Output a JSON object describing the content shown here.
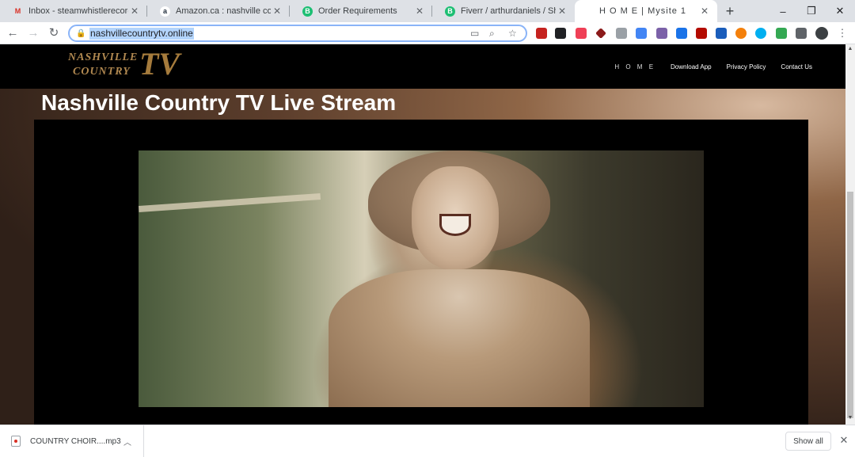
{
  "browser": {
    "tabs": [
      {
        "title": "Inbox - steamwhistlerecords@",
        "favicon": "gmail-icon",
        "fav_letter": "M",
        "fav_color": "#d93025"
      },
      {
        "title": "Amazon.ca : nashville country t",
        "favicon": "amazon-icon",
        "fav_letter": "a",
        "fav_color": "#232f3e"
      },
      {
        "title": "Order Requirements",
        "favicon": "fiverr-icon",
        "fav_letter": "B",
        "fav_color": "#1dbf73"
      },
      {
        "title": "Fiverr / arthurdaniels / Shoppin",
        "favicon": "fiverr-icon",
        "fav_letter": "B",
        "fav_color": "#1dbf73"
      },
      {
        "title": "H O M E | Mysite 1",
        "favicon": "",
        "fav_letter": "",
        "fav_color": ""
      }
    ],
    "new_tab_glyph": "+",
    "window_controls": {
      "minimize": "–",
      "restore": "❐",
      "close": "✕"
    },
    "nav": {
      "back": "←",
      "forward": "→",
      "reload": "↻"
    },
    "url": "nashvillecountrytv.online",
    "extensions": [
      {
        "name": "ext-red-icon",
        "color": "#c5221f"
      },
      {
        "name": "ext-tv-icon",
        "color": "#202124"
      },
      {
        "name": "ext-pocket-icon",
        "color": "#ef4056"
      },
      {
        "name": "ext-diamond-icon",
        "color": "#8b1a1a"
      },
      {
        "name": "ext-hex-icon",
        "color": "#9aa0a6"
      },
      {
        "name": "ext-cube-icon",
        "color": "#4285f4"
      },
      {
        "name": "ext-square-icon",
        "color": "#7b61a8"
      },
      {
        "name": "ext-bars-icon",
        "color": "#1a73e8"
      },
      {
        "name": "ext-pdf-icon",
        "color": "#b30b00"
      },
      {
        "name": "ext-blue-icon",
        "color": "#1a5dbb"
      },
      {
        "name": "ext-orange-icon",
        "color": "#f4800b"
      },
      {
        "name": "ext-skype-icon",
        "color": "#00aff0"
      },
      {
        "name": "ext-check-icon",
        "color": "#34a853"
      },
      {
        "name": "puzzle-icon",
        "color": "#5f6368"
      },
      {
        "name": "profile-avatar-icon",
        "color": "#3c4043"
      }
    ]
  },
  "site": {
    "logo_line1": "NASHVILLE",
    "logo_line2": "COUNTRY",
    "logo_tv": "TV",
    "nav": [
      "H O M E",
      "Download App",
      "Privacy Policy",
      "Contact Us"
    ],
    "hero_title": "Nashville Country TV Live Stream"
  },
  "downloads": {
    "file_name": "COUNTRY CHOIR....mp3",
    "show_all": "Show all",
    "close": "✕"
  }
}
